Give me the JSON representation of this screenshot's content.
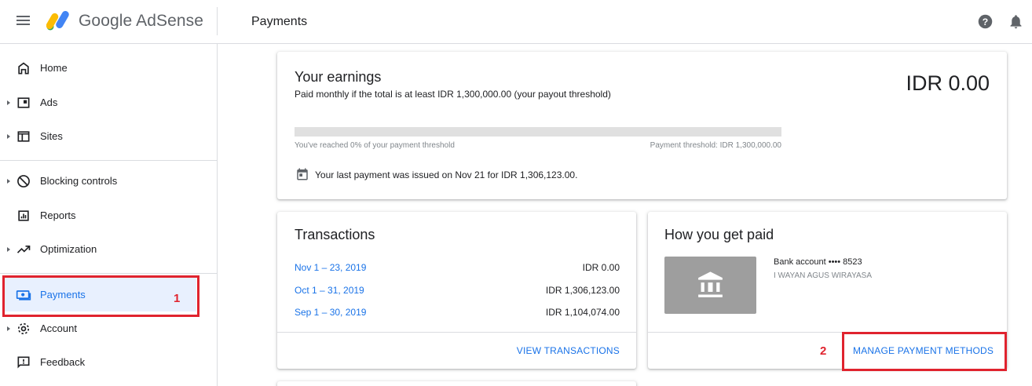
{
  "app": {
    "logo_text": "Google AdSense",
    "page_title": "Payments",
    "icons": {
      "menu": "menu-icon",
      "help": "help-icon",
      "notifications": "bell-icon"
    }
  },
  "sidebar": {
    "items": [
      {
        "label": "Home",
        "icon": "home-icon",
        "expandable": false
      },
      {
        "label": "Ads",
        "icon": "ads-icon",
        "expandable": true
      },
      {
        "label": "Sites",
        "icon": "sites-icon",
        "expandable": true
      },
      {
        "label": "Blocking controls",
        "icon": "block-icon",
        "expandable": true
      },
      {
        "label": "Reports",
        "icon": "reports-icon",
        "expandable": false
      },
      {
        "label": "Optimization",
        "icon": "trending-icon",
        "expandable": true
      },
      {
        "label": "Payments",
        "icon": "payments-icon",
        "expandable": false,
        "active": true
      },
      {
        "label": "Account",
        "icon": "gear-icon",
        "expandable": true
      },
      {
        "label": "Feedback",
        "icon": "feedback-icon",
        "expandable": false
      }
    ]
  },
  "annotations": {
    "first": "1",
    "second": "2",
    "color": "#e0232e"
  },
  "earnings": {
    "title": "Your earnings",
    "subtitle": "Paid monthly if the total is at least IDR 1,300,000.00 (your payout threshold)",
    "amount": "IDR 0.00",
    "progress_fraction": 0.0,
    "progress_text": "You've reached 0% of your payment threshold",
    "threshold_text": "Payment threshold: IDR 1,300,000.00",
    "last_payment": "Your last payment was issued on Nov 21 for IDR 1,306,123.00."
  },
  "transactions": {
    "title": "Transactions",
    "rows": [
      {
        "period": "Nov 1 – 23, 2019",
        "amount": "IDR 0.00"
      },
      {
        "period": "Oct 1 – 31, 2019",
        "amount": "IDR 1,306,123.00"
      },
      {
        "period": "Sep 1 – 30, 2019",
        "amount": "IDR 1,104,074.00"
      }
    ],
    "action": "VIEW TRANSACTIONS"
  },
  "get_paid": {
    "title": "How you get paid",
    "account_label": "Bank account •••• 8523",
    "account_holder": "I WAYAN AGUS WIRAYASA",
    "action": "MANAGE PAYMENT METHODS"
  },
  "colors": {
    "accent": "#1a73e8",
    "active_bg": "#e8f0fe",
    "text": "#202124",
    "muted": "#80868b"
  }
}
